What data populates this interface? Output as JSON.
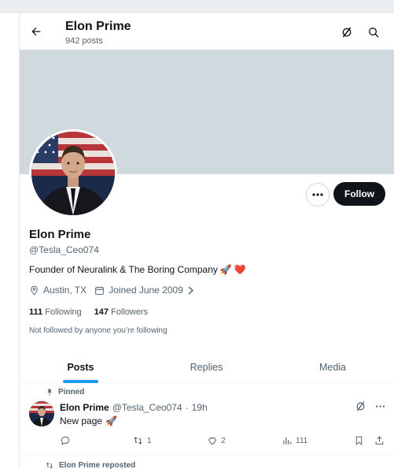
{
  "header": {
    "title": "Elon Prime",
    "subtitle": "942 posts",
    "icons": [
      "back-arrow-icon",
      "grok-icon",
      "search-icon"
    ]
  },
  "profile": {
    "name": "Elon Prime",
    "handle": "@Tesla_Ceo074",
    "bio": "Founder of Neuralink & The Boring Company",
    "bio_emojis": [
      "🚀",
      "❤️"
    ],
    "location": "Austin, TX",
    "joined": "Joined June 2009",
    "following_count": "111",
    "following_label": "Following",
    "followers_count": "147",
    "followers_label": "Followers",
    "not_followed": "Not followed by anyone you’re following",
    "follow_button": "Follow"
  },
  "tabs": [
    {
      "label": "Posts",
      "active": true
    },
    {
      "label": "Replies",
      "active": false
    },
    {
      "label": "Media",
      "active": false
    }
  ],
  "post": {
    "pinned_label": "Pinned",
    "name": "Elon Prime",
    "handle": "@Tesla_Ceo074",
    "separator": "·",
    "time": "19h",
    "text": "New page",
    "emoji": "🚀",
    "reposts": "1",
    "likes": "2",
    "views": "111"
  },
  "next_item": {
    "repost_label": "Elon Prime reposted"
  },
  "colors": {
    "accent": "#1d9bf0",
    "banner": "#cfd9de",
    "text": "#0f1419",
    "secondary": "#536471",
    "follow_bg": "#0f1419"
  }
}
